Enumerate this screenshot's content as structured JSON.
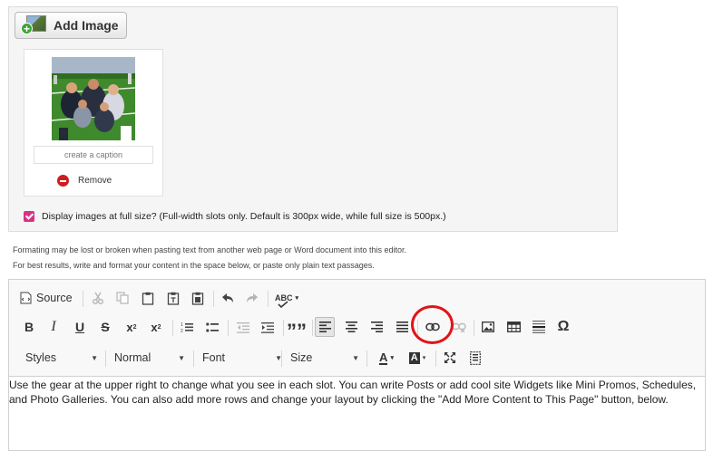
{
  "image_panel": {
    "add_image_label": "Add Image",
    "caption_placeholder": "create a caption",
    "remove_label": "Remove",
    "fullsize_label": "Display images at full size? (Full-width slots only. Default is 300px wide, while full size is 500px.)",
    "fullsize_checked": true
  },
  "notes": {
    "line1": "Formating may be lost or broken when pasting text from another web page or Word document into this editor.",
    "line2": "For best results, write and format your content in the space below, or paste only plain text passages."
  },
  "toolbar": {
    "source_label": "Source",
    "spellcheck_label": "ABC",
    "styles_label": "Styles",
    "format_label": "Normal",
    "font_label": "Font",
    "size_label": "Size",
    "italic_label": "I",
    "bold_label": "B",
    "underline_label": "U",
    "strike_label": "S",
    "omega_label": "Ω",
    "quote_label": "”",
    "text_color_label": "A",
    "bg_color_label": "A"
  },
  "content": {
    "text": "Use the gear at the upper right to change what you see in each slot. You can write Posts or add cool site Widgets like Mini Promos, Schedules, and Photo Galleries. You can also add more rows and change your layout by clicking the \"Add More Content to This Page\" button, below."
  },
  "colors": {
    "checkbox": "#d63384",
    "remove_icon": "#cc1f1f",
    "highlight_circle": "#e0151a"
  }
}
